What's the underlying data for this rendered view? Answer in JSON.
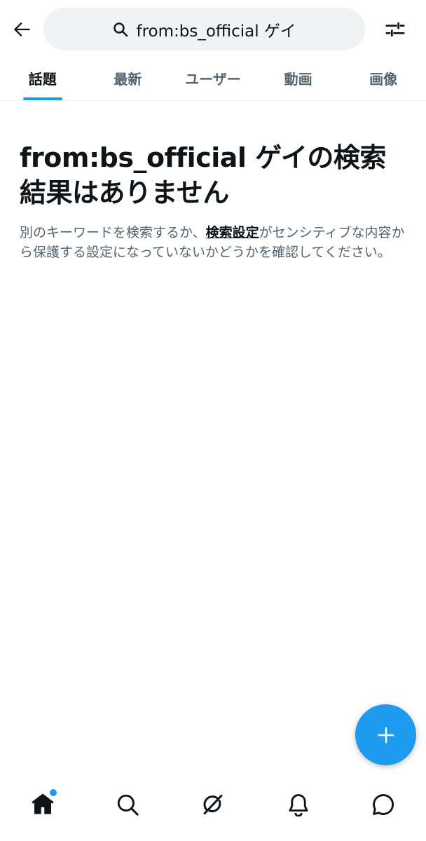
{
  "header": {
    "search_query": "from:bs_official ゲイ",
    "icons": {
      "back": "back-arrow-icon",
      "search": "search-icon",
      "filter": "filter-sliders-icon"
    }
  },
  "tabs": [
    {
      "label": "話題",
      "active": true
    },
    {
      "label": "最新",
      "active": false
    },
    {
      "label": "ユーザー",
      "active": false
    },
    {
      "label": "動画",
      "active": false
    },
    {
      "label": "画像",
      "active": false
    }
  ],
  "empty_state": {
    "title": "from:bs_official ゲイの検索結果はありません",
    "desc_before": "別のキーワードを検索するか、",
    "desc_link": "検索設定",
    "desc_after": "がセンシティブな内容から保護する設定になっていないかどうかを確認してください。"
  },
  "bottom_nav": [
    "home-icon",
    "search-icon",
    "grok-icon",
    "notifications-bell-icon",
    "messages-icon"
  ],
  "colors": {
    "accent": "#1d9bf0",
    "text_primary": "#0f1419",
    "text_secondary": "#536471",
    "search_bg": "#eff3f4"
  }
}
